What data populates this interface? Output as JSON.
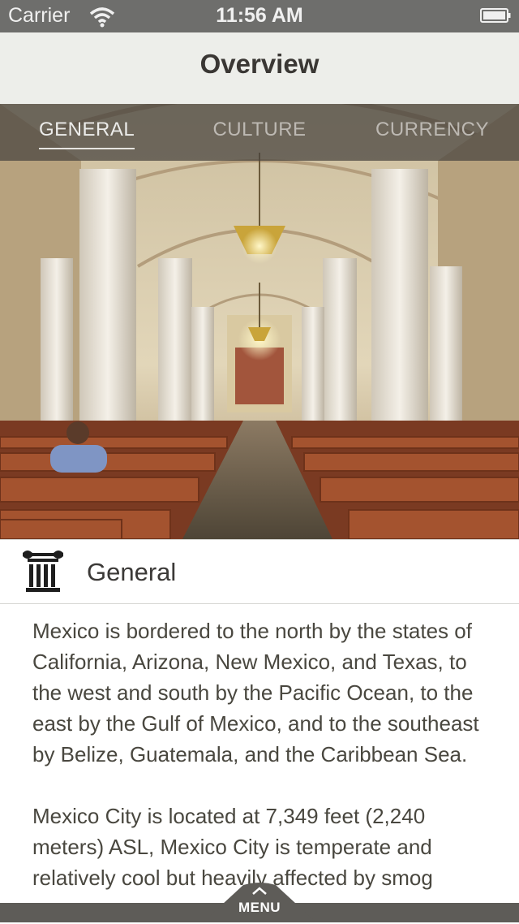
{
  "status_bar": {
    "carrier": "Carrier",
    "time": "11:56 AM"
  },
  "nav": {
    "title": "Overview"
  },
  "tabs": [
    {
      "label": "GENERAL",
      "active": true
    },
    {
      "label": "CULTURE",
      "active": false
    },
    {
      "label": "CURRENCY",
      "active": false
    }
  ],
  "section": {
    "title": "General",
    "icon": "column-icon"
  },
  "content": {
    "paragraphs": [
      "Mexico is bordered to the north by the states of California, Arizona, New Mexico, and Texas, to the west and south by the Pacific Ocean, to the east by the Gulf of Mexico, and to the southeast by Belize, Guatemala, and the Caribbean Sea.",
      "Mexico City is located at 7,349 feet (2,240 meters) ASL, Mexico City is temperate and relatively cool but heavily affected by smog"
    ]
  },
  "menu": {
    "label": "MENU"
  },
  "colors": {
    "status_bar": "#6e6e6c",
    "nav_bar": "#edeeea",
    "tab_overlay": "#46423e",
    "text": "#49473f",
    "menu_bar": "#5e5c58"
  }
}
